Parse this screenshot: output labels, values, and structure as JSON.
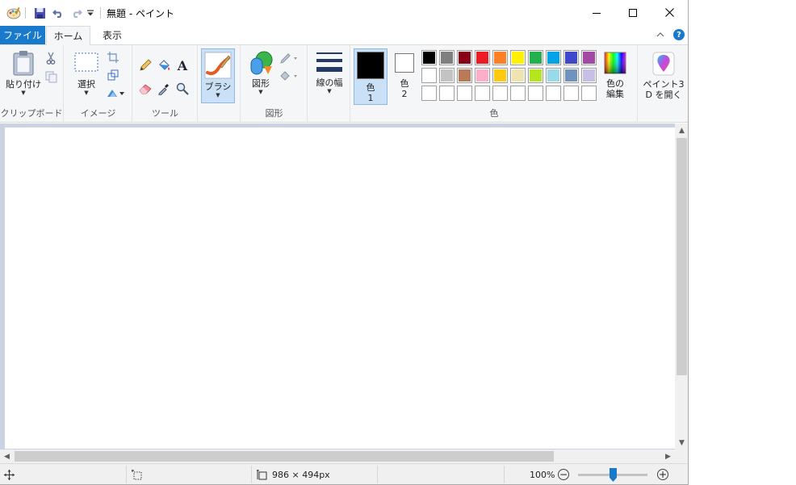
{
  "window": {
    "title": "無題 - ペイント",
    "controls": {
      "minimize": "minimize-icon",
      "maximize": "maximize-icon",
      "close": "close-icon"
    }
  },
  "tabs": [
    {
      "label": "ファイル",
      "active": false
    },
    {
      "label": "ホーム",
      "active": true
    },
    {
      "label": "表示",
      "active": false
    }
  ],
  "help": "?",
  "ribbon": {
    "clipboard": {
      "group": "クリップボード",
      "paste": "貼り付け"
    },
    "image": {
      "group": "イメージ",
      "select": "選択"
    },
    "tools": {
      "group": "ツール"
    },
    "brushes": {
      "label": "ブラシ"
    },
    "shapes": {
      "group": "図形",
      "label": "図形"
    },
    "size": {
      "label": "線の幅"
    },
    "colors": {
      "group": "色",
      "color1_line1": "色",
      "color1_line2": "1",
      "color2_line1": "色",
      "color2_line2": "2",
      "edit_line1": "色の",
      "edit_line2": "編集",
      "paint3d_line1": "ペイント3",
      "paint3d_line2": "D を開く",
      "color1_value": "#000000",
      "color2_value": "#ffffff",
      "palette_row1": [
        "#000000",
        "#7f7f7f",
        "#880015",
        "#ed1c24",
        "#ff7f27",
        "#fff200",
        "#22b14c",
        "#00a2e8",
        "#3f48cc",
        "#a349a4"
      ],
      "palette_row2": [
        "#ffffff",
        "#c3c3c3",
        "#b97a57",
        "#ffaec9",
        "#ffc90e",
        "#efe4b0",
        "#b5e61d",
        "#99d9ea",
        "#7092be",
        "#c8bfe7"
      ],
      "palette_row3": [
        "#ffffff",
        "#ffffff",
        "#ffffff",
        "#ffffff",
        "#ffffff",
        "#ffffff",
        "#ffffff",
        "#ffffff",
        "#ffffff",
        "#ffffff"
      ]
    }
  },
  "accent": "#1979ca",
  "status": {
    "canvas_size": "986 × 494px",
    "zoom": "100%",
    "zoom_fraction": 0.5
  }
}
